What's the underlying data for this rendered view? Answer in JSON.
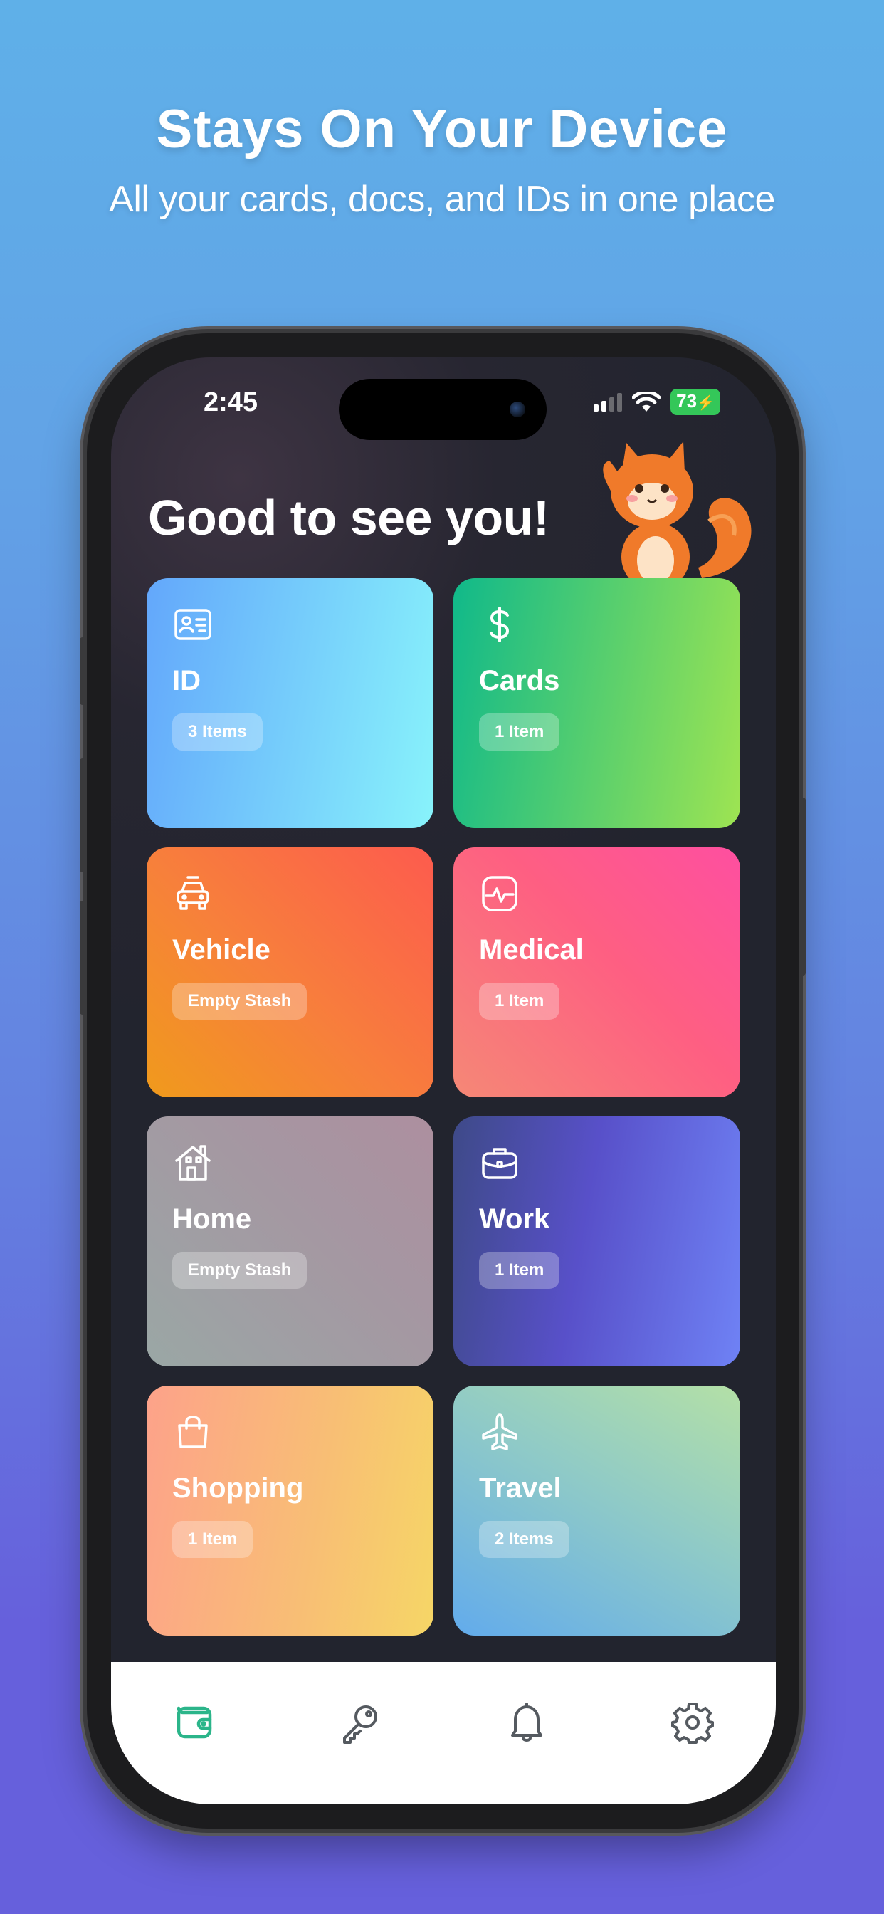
{
  "headline": "Stays On Your Device",
  "subhead": "All your cards, docs, and IDs in one place",
  "status": {
    "time": "2:45",
    "battery": "73"
  },
  "greeting": "Good to see you!",
  "categories": [
    {
      "title": "ID",
      "badge": "3 Items",
      "icon": "id-card-icon"
    },
    {
      "title": "Cards",
      "badge": "1 Item",
      "icon": "dollar-icon"
    },
    {
      "title": "Vehicle",
      "badge": "Empty Stash",
      "icon": "car-icon"
    },
    {
      "title": "Medical",
      "badge": "1 Item",
      "icon": "heartbeat-icon"
    },
    {
      "title": "Home",
      "badge": "Empty Stash",
      "icon": "house-icon"
    },
    {
      "title": "Work",
      "badge": "1 Item",
      "icon": "briefcase-icon"
    },
    {
      "title": "Shopping",
      "badge": "1 Item",
      "icon": "shopping-bag-icon"
    },
    {
      "title": "Travel",
      "badge": "2 Items",
      "icon": "airplane-icon"
    }
  ],
  "tabbar": {
    "active": "wallet",
    "active_color": "#2bb58a",
    "inactive_color": "#555a60",
    "tabs": [
      "wallet-icon",
      "key-icon",
      "bell-icon",
      "gear-icon"
    ]
  }
}
